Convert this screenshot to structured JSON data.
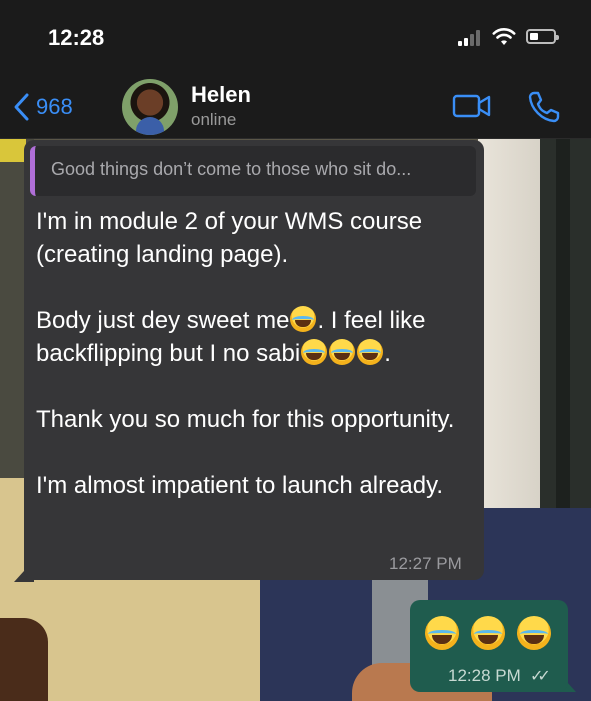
{
  "status_bar": {
    "time": "12:28"
  },
  "header": {
    "back_count": "968",
    "contact_name": "Helen",
    "contact_status": "online"
  },
  "messages": [
    {
      "direction": "incoming",
      "quoted_text": "Good things don’t come to those who sit do...",
      "paragraphs": [
        "I'm in module 2 of your WMS course (creating landing page).",
        "Body just dey sweet me",
        ". I feel like backflipping but I no sabi",
        ".",
        "Thank you so much for this opportunity.",
        "I'm almost impatient to launch already."
      ],
      "time": "12:27 PM"
    },
    {
      "direction": "outgoing",
      "emoji_count": 3,
      "time": "12:28 PM"
    }
  ],
  "icons": {
    "back": "chevron-left-icon",
    "video": "video-camera-icon",
    "call": "phone-icon",
    "emoji": "tears-of-joy-emoji",
    "read_receipt": "double-check-icon"
  },
  "colors": {
    "accent": "#3a8ef6",
    "incoming_bubble": "#363638",
    "outgoing_bubble": "#1f5c4e",
    "quote_bar": "#b06fd8"
  }
}
